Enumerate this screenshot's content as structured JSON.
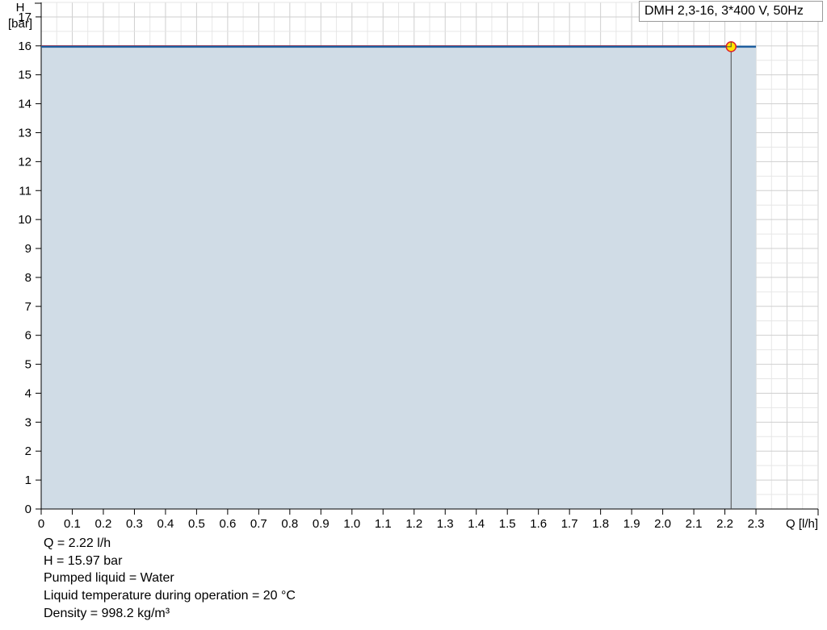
{
  "chart_data": {
    "type": "area",
    "ylabel_line1": "H",
    "ylabel_line2": "[bar]",
    "xlabel": "Q [l/h]",
    "xlim": [
      0,
      2.5
    ],
    "ylim": [
      0,
      17.5
    ],
    "x_ticks": [
      "0",
      "0.1",
      "0.2",
      "0.3",
      "0.4",
      "0.5",
      "0.6",
      "0.7",
      "0.8",
      "0.9",
      "1.0",
      "1.1",
      "1.2",
      "1.3",
      "1.4",
      "1.5",
      "1.6",
      "1.7",
      "1.8",
      "1.9",
      "2.0",
      "2.1",
      "2.2",
      "2.3"
    ],
    "y_ticks": [
      "0",
      "1",
      "2",
      "3",
      "4",
      "5",
      "6",
      "7",
      "8",
      "9",
      "10",
      "11",
      "12",
      "13",
      "14",
      "15",
      "16",
      "17"
    ],
    "grid": true,
    "legend_position": "top-right",
    "series": [
      {
        "name": "DMH 2,3-16, 3*400 V, 50Hz",
        "x": [
          0,
          2.3
        ],
        "y": [
          15.97,
          15.97
        ],
        "color": "#1f5f9f",
        "fill": "#d0dce6"
      }
    ],
    "system_curve": {
      "color": "#e0202a",
      "x": [
        0,
        2.22
      ],
      "y": [
        16.0,
        16.0
      ]
    },
    "operating_point": {
      "x": 2.22,
      "y": 15.97,
      "color": "#ffe500",
      "stroke": "#e0202a"
    }
  },
  "info": [
    "Q = 2.22 l/h",
    "H = 15.97 bar",
    "Pumped liquid = Water",
    "Liquid temperature during operation = 20 °C",
    "Density = 998.2 kg/m³"
  ]
}
